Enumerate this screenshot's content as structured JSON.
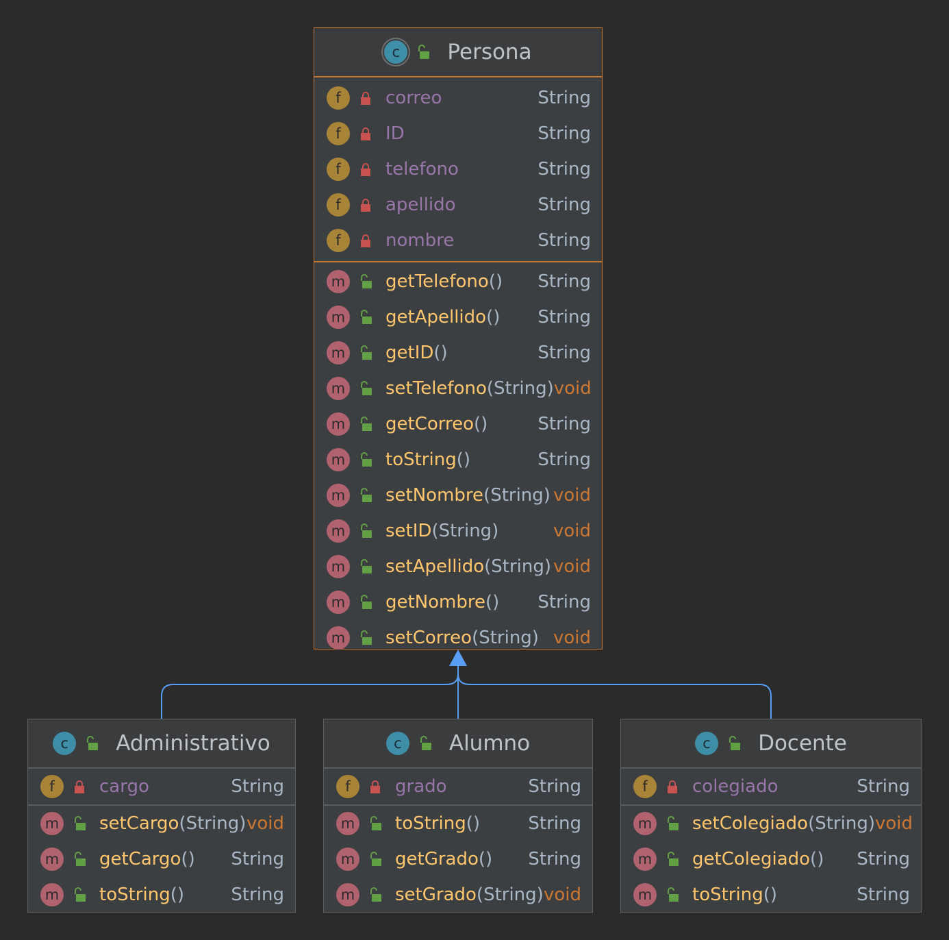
{
  "colors": {
    "background": "#2b2b2b",
    "selected_border": "#c87832",
    "field_badge": "#a88438",
    "method_badge": "#b0626e",
    "class_badge": "#3f8ea8",
    "field_name": "#9876aa",
    "method_name": "#ffc66d",
    "void_type": "#cc7832",
    "arrow": "#589df6"
  },
  "classes": [
    {
      "name": "Persona",
      "icon": "class-icon",
      "fields": [
        {
          "name": "correo",
          "type": "String"
        },
        {
          "name": "ID",
          "type": "String"
        },
        {
          "name": "telefono",
          "type": "String"
        },
        {
          "name": "apellido",
          "type": "String"
        },
        {
          "name": "nombre",
          "type": "String"
        }
      ],
      "methods": [
        {
          "name": "getTelefono",
          "params": "()",
          "type": "String"
        },
        {
          "name": "getApellido",
          "params": "()",
          "type": "String"
        },
        {
          "name": "getID",
          "params": "()",
          "type": "String"
        },
        {
          "name": "setTelefono",
          "params": "(String)",
          "type": "void"
        },
        {
          "name": "getCorreo",
          "params": "()",
          "type": "String"
        },
        {
          "name": "toString",
          "params": "()",
          "type": "String"
        },
        {
          "name": "setNombre",
          "params": "(String)",
          "type": "void"
        },
        {
          "name": "setID",
          "params": "(String)",
          "type": "void"
        },
        {
          "name": "setApellido",
          "params": "(String)",
          "type": "void"
        },
        {
          "name": "getNombre",
          "params": "()",
          "type": "String"
        },
        {
          "name": "setCorreo",
          "params": "(String)",
          "type": "void"
        }
      ]
    },
    {
      "name": "Administrativo",
      "icon": "class-icon",
      "fields": [
        {
          "name": "cargo",
          "type": "String"
        }
      ],
      "methods": [
        {
          "name": "setCargo",
          "params": "(String)",
          "type": "void"
        },
        {
          "name": "getCargo",
          "params": "()",
          "type": "String"
        },
        {
          "name": "toString",
          "params": "()",
          "type": "String"
        }
      ]
    },
    {
      "name": "Alumno",
      "icon": "class-icon",
      "fields": [
        {
          "name": "grado",
          "type": "String"
        }
      ],
      "methods": [
        {
          "name": "toString",
          "params": "()",
          "type": "String"
        },
        {
          "name": "getGrado",
          "params": "()",
          "type": "String"
        },
        {
          "name": "setGrado",
          "params": "(String)",
          "type": "void"
        }
      ]
    },
    {
      "name": "Docente",
      "icon": "class-icon",
      "fields": [
        {
          "name": "colegiado",
          "type": "String"
        }
      ],
      "methods": [
        {
          "name": "setColegiado",
          "params": "(String)",
          "type": "void"
        },
        {
          "name": "getColegiado",
          "params": "()",
          "type": "String"
        },
        {
          "name": "toString",
          "params": "()",
          "type": "String"
        }
      ]
    }
  ],
  "inheritance": [
    {
      "child": "Administrativo",
      "parent": "Persona"
    },
    {
      "child": "Alumno",
      "parent": "Persona"
    },
    {
      "child": "Docente",
      "parent": "Persona"
    }
  ]
}
